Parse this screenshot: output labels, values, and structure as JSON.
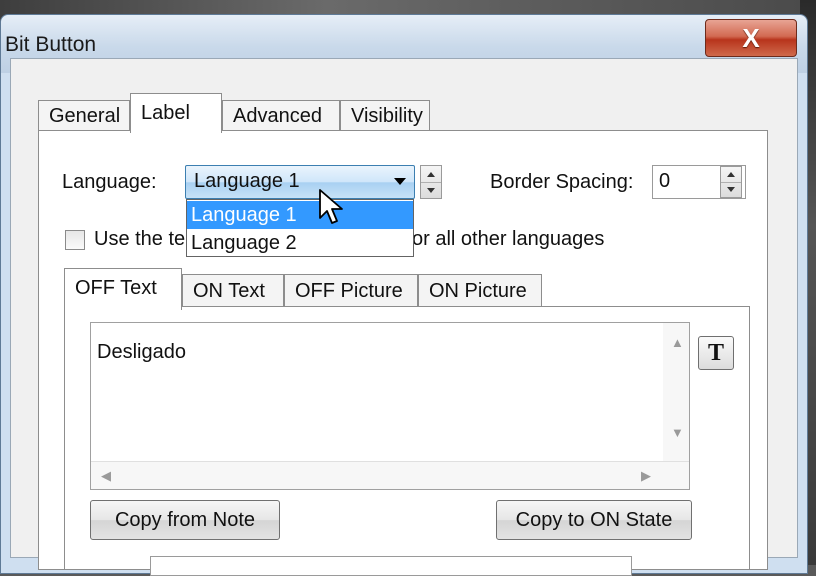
{
  "window": {
    "title": "Bit Button",
    "close_glyph": "X"
  },
  "tabs": [
    {
      "label": "General",
      "selected": false
    },
    {
      "label": "Label",
      "selected": true
    },
    {
      "label": "Advanced",
      "selected": false
    },
    {
      "label": "Visibility",
      "selected": false
    }
  ],
  "language": {
    "label": "Language:",
    "value": "Language 1",
    "options": [
      "Language 1",
      "Language 2"
    ],
    "highlighted": "Language 1"
  },
  "border_spacing": {
    "label": "Border Spacing:",
    "value": "0"
  },
  "checkbox": {
    "label_start": "Use the te",
    "label_end": "or all other languages",
    "checked": false
  },
  "subtabs": [
    {
      "label": "OFF Text",
      "selected": true
    },
    {
      "label": "ON Text",
      "selected": false
    },
    {
      "label": "OFF Picture",
      "selected": false
    },
    {
      "label": "ON Picture",
      "selected": false
    }
  ],
  "editor": {
    "text": "Desligado",
    "font_button": "T"
  },
  "buttons": {
    "copy_from_note": "Copy from Note",
    "copy_to_on_state": "Copy to ON State"
  },
  "icons": {
    "close": "close-icon",
    "font": "font-icon",
    "cursor": "mouse-pointer-icon"
  }
}
